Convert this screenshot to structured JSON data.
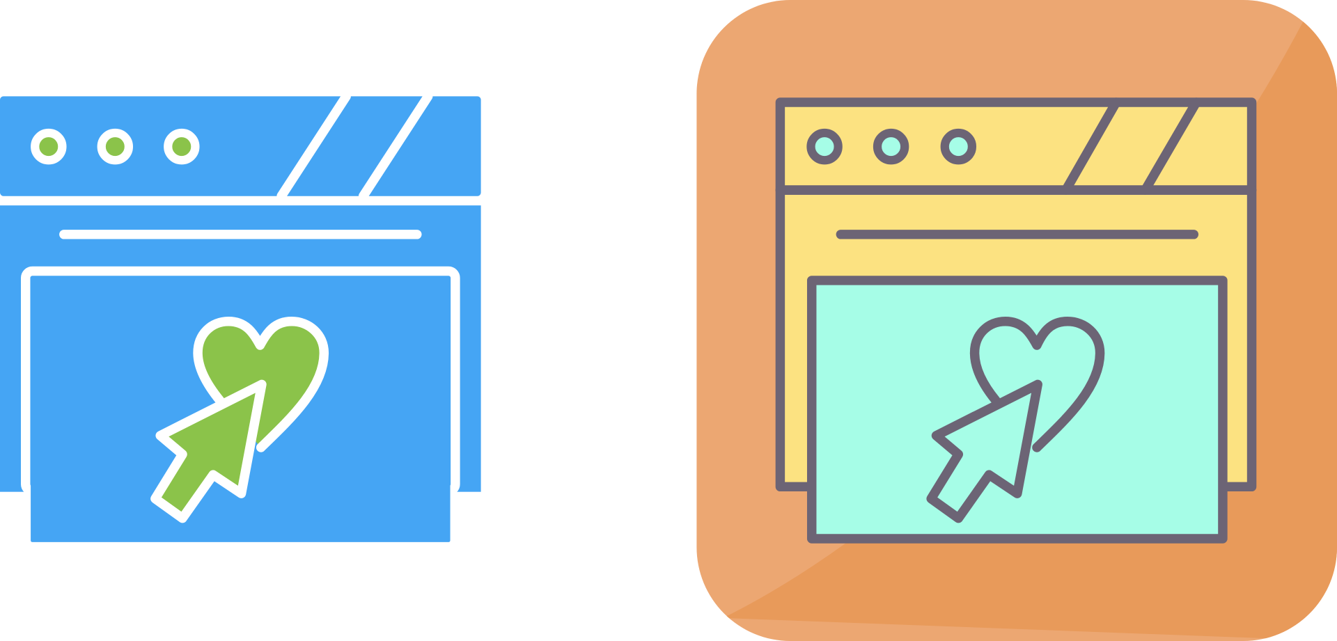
{
  "icons": [
    {
      "name": "favorite-web-page-glyph-icon",
      "style": "glyph",
      "colors": {
        "window": "#45A5F4",
        "outline": "#FFFFFF",
        "dots": "#8BC34A",
        "heart": "#8BC34A",
        "cursor": "#8BC34A"
      }
    },
    {
      "name": "favorite-web-page-flat-icon",
      "style": "flat-color",
      "colors": {
        "tile": "#ECA772",
        "tile_shade": "#E89A5A",
        "window": "#FCE281",
        "outline": "#6C6475",
        "dots": "#A6FDE7",
        "screen": "#A6FDE7"
      }
    }
  ]
}
